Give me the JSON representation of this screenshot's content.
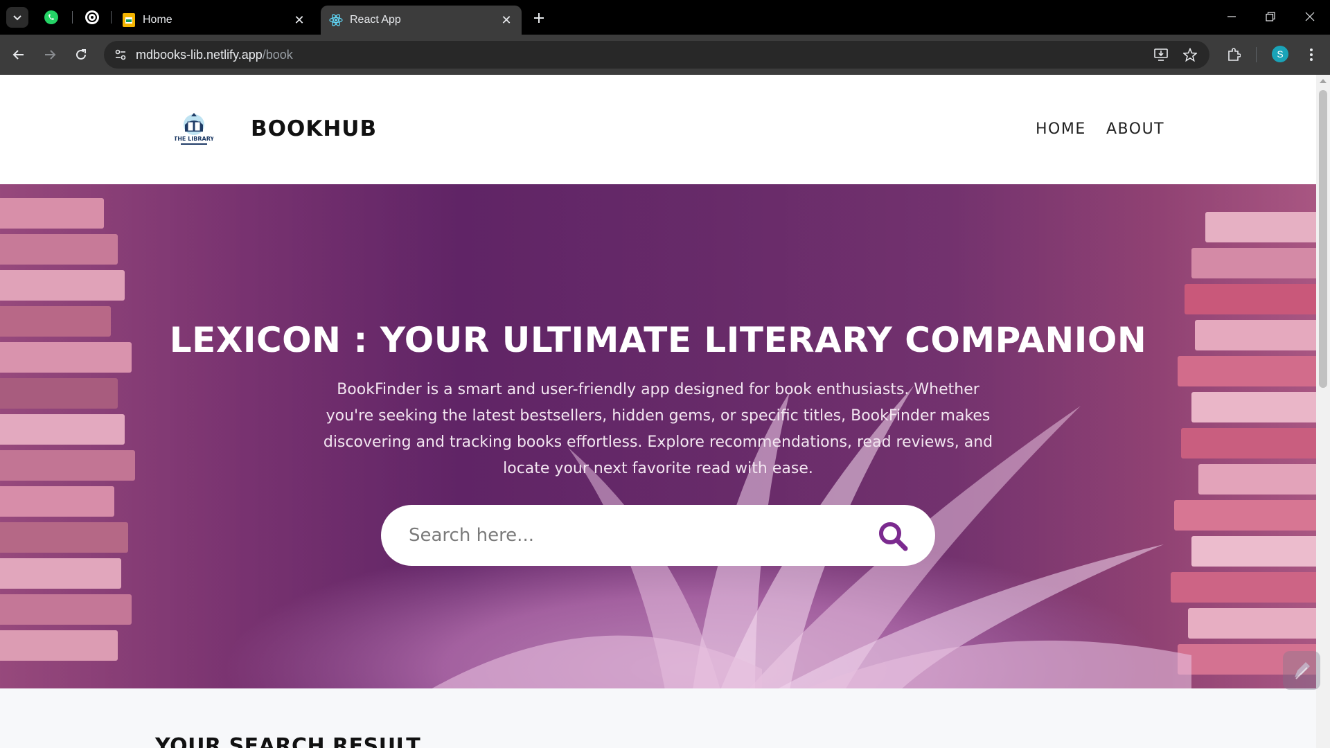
{
  "browser": {
    "tabs": [
      {
        "title": "Home",
        "active": false
      },
      {
        "title": "React App",
        "active": true
      }
    ],
    "url_host": "mdbooks-lib.netlify.app",
    "url_path": "/book",
    "profile_initial": "S"
  },
  "site": {
    "brand": "BOOKHUB",
    "logo_text": "THE LIBRARY",
    "nav": [
      {
        "label": "HOME"
      },
      {
        "label": "ABOUT"
      }
    ]
  },
  "hero": {
    "title": "LEXICON : YOUR ULTIMATE LITERARY COMPANION",
    "description": "BookFinder is a smart and user-friendly app designed for book enthusiasts. Whether you're seeking the latest bestsellers, hidden gems, or specific titles, BookFinder makes discovering and tracking books effortless. Explore recommendations, read reviews, and locate your next favorite read with ease.",
    "search_placeholder": "Search here...",
    "search_value": ""
  },
  "results": {
    "heading": "YOUR SEARCH RESULT"
  },
  "colors": {
    "accent": "#7b2a8f",
    "chrome_dark": "#000000",
    "toolbar": "#3c3c3c",
    "profile": "#1aa3b8"
  }
}
